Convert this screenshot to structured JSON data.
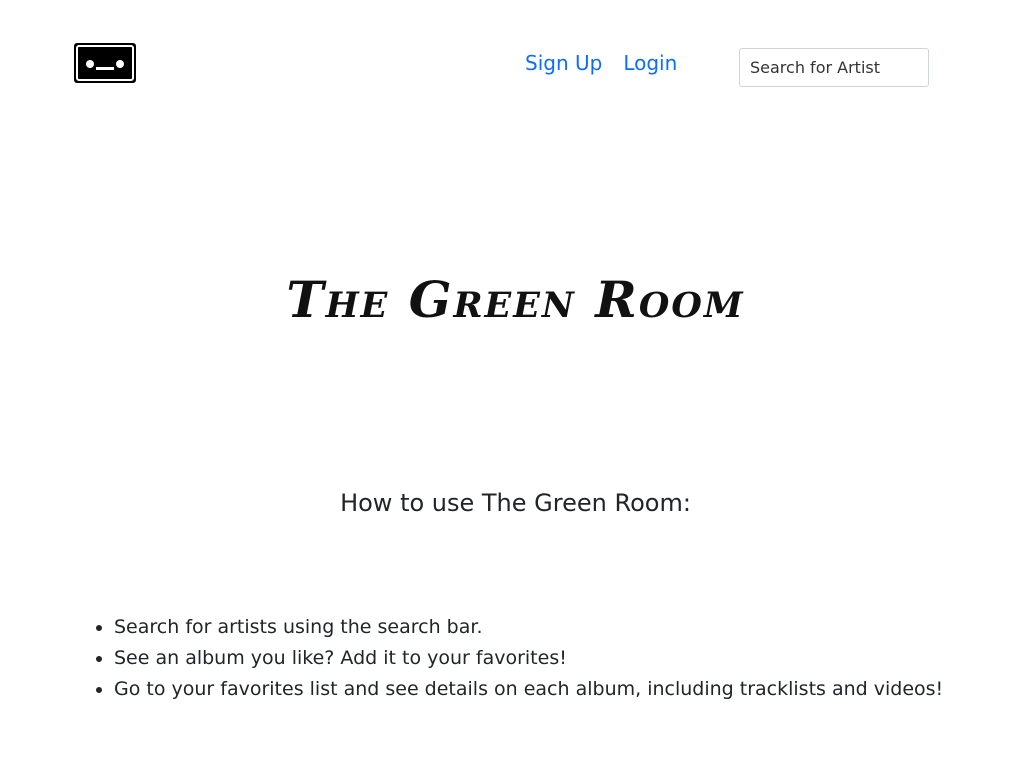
{
  "navbar": {
    "logo_icon": "cassette-tape-icon",
    "links": [
      {
        "label": "Sign Up"
      },
      {
        "label": "Login"
      }
    ],
    "search": {
      "placeholder": "Search for Artist",
      "value": ""
    },
    "link_color": "#0d6efd"
  },
  "hero": {
    "title": "The Green Room"
  },
  "howto": {
    "heading": "How to use The Green Room:",
    "steps": [
      "Search for artists using the search bar.",
      "See an album you like? Add it to your favorites!",
      "Go to your favorites list and see details on each album, including tracklists and videos!"
    ]
  }
}
